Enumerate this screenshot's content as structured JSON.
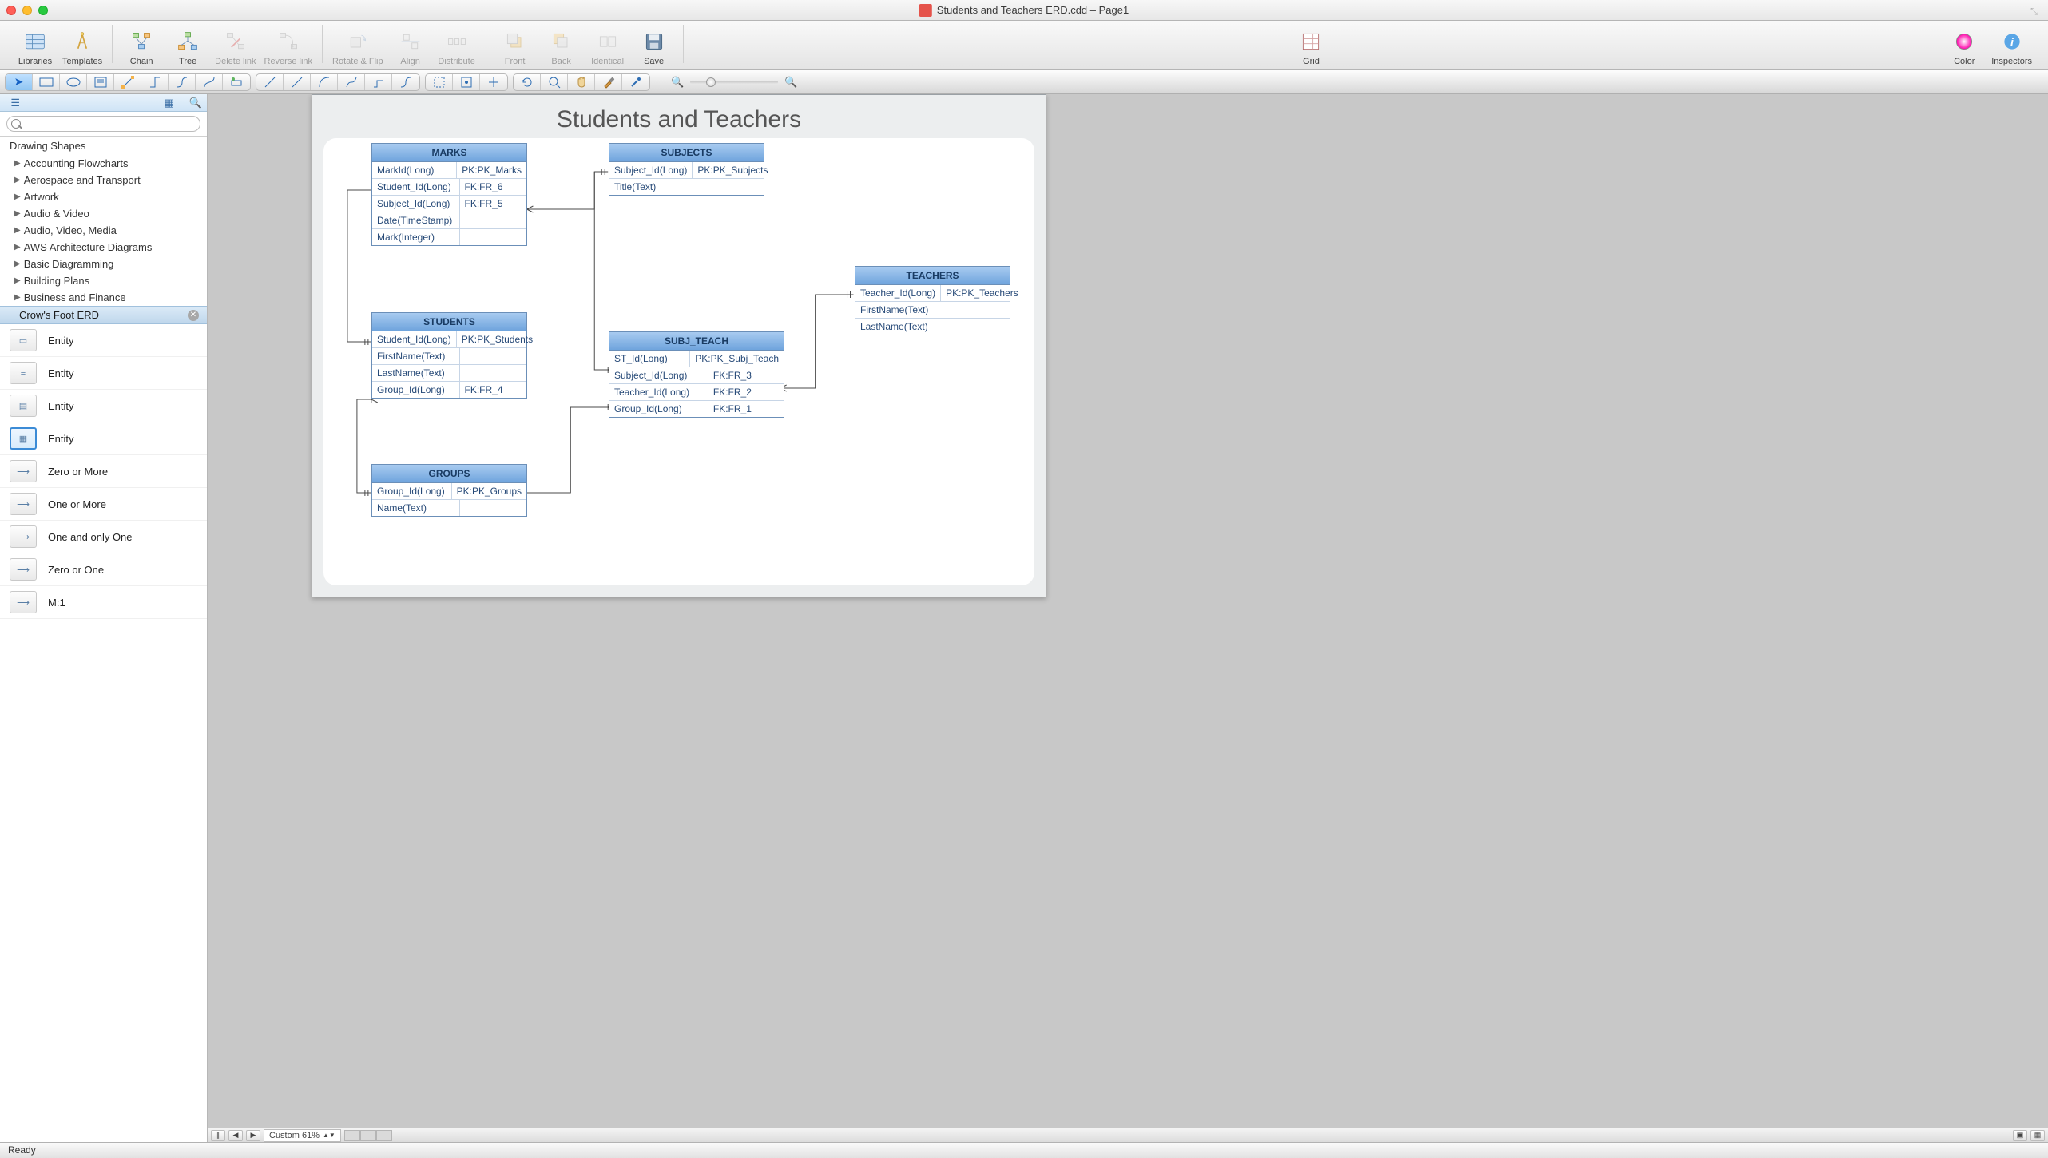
{
  "window": {
    "title": "Students and Teachers ERD.cdd – Page1"
  },
  "toolbar": {
    "libraries": "Libraries",
    "templates": "Templates",
    "chain": "Chain",
    "tree": "Tree",
    "delete_link": "Delete link",
    "reverse_link": "Reverse link",
    "rotate_flip": "Rotate & Flip",
    "align": "Align",
    "distribute": "Distribute",
    "front": "Front",
    "back": "Back",
    "identical": "Identical",
    "save": "Save",
    "grid": "Grid",
    "color": "Color",
    "inspectors": "Inspectors"
  },
  "sidebar": {
    "search_placeholder": "",
    "heading": "Drawing Shapes",
    "categories": [
      "Accounting Flowcharts",
      "Aerospace and Transport",
      "Artwork",
      "Audio & Video",
      "Audio, Video, Media",
      "AWS Architecture Diagrams",
      "Basic Diagramming",
      "Building Plans",
      "Business and Finance"
    ],
    "active_section": "Crow's Foot ERD",
    "shapes": [
      {
        "label": "Entity"
      },
      {
        "label": "Entity"
      },
      {
        "label": "Entity"
      },
      {
        "label": "Entity",
        "selected": true
      },
      {
        "label": "Zero or More"
      },
      {
        "label": "One or More"
      },
      {
        "label": "One and only One"
      },
      {
        "label": "Zero or One"
      },
      {
        "label": "M:1"
      }
    ]
  },
  "canvas": {
    "title": "Students and Teachers",
    "zoom_label": "Custom 61%"
  },
  "entities": {
    "marks": {
      "name": "MARKS",
      "rows": [
        [
          "MarkId(Long)",
          "PK:PK_Marks"
        ],
        [
          "Student_Id(Long)",
          "FK:FR_6"
        ],
        [
          "Subject_Id(Long)",
          "FK:FR_5"
        ],
        [
          "Date(TimeStamp)",
          ""
        ],
        [
          "Mark(Integer)",
          ""
        ]
      ]
    },
    "subjects": {
      "name": "SUBJECTS",
      "rows": [
        [
          "Subject_Id(Long)",
          "PK:PK_Subjects"
        ],
        [
          "Title(Text)",
          ""
        ]
      ]
    },
    "students": {
      "name": "STUDENTS",
      "rows": [
        [
          "Student_Id(Long)",
          "PK:PK_Students"
        ],
        [
          "FirstName(Text)",
          ""
        ],
        [
          "LastName(Text)",
          ""
        ],
        [
          "Group_Id(Long)",
          "FK:FR_4"
        ]
      ]
    },
    "subj_teach": {
      "name": "SUBJ_TEACH",
      "rows": [
        [
          "ST_Id(Long)",
          "PK:PK_Subj_Teach"
        ],
        [
          "Subject_Id(Long)",
          "FK:FR_3"
        ],
        [
          "Teacher_Id(Long)",
          "FK:FR_2"
        ],
        [
          "Group_Id(Long)",
          "FK:FR_1"
        ]
      ]
    },
    "teachers": {
      "name": "TEACHERS",
      "rows": [
        [
          "Teacher_Id(Long)",
          "PK:PK_Teachers"
        ],
        [
          "FirstName(Text)",
          ""
        ],
        [
          "LastName(Text)",
          ""
        ]
      ]
    },
    "groups": {
      "name": "GROUPS",
      "rows": [
        [
          "Group_Id(Long)",
          "PK:PK_Groups"
        ],
        [
          "Name(Text)",
          ""
        ]
      ]
    }
  },
  "status": {
    "text": "Ready"
  }
}
